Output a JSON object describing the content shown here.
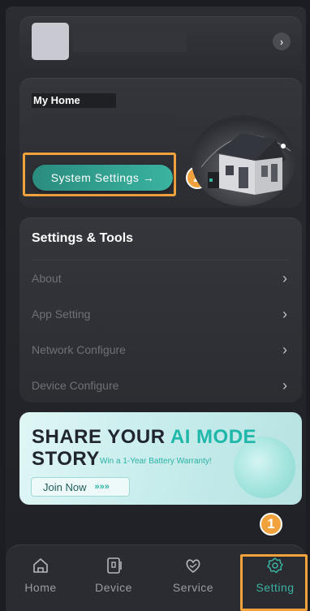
{
  "home_card": {
    "title": "My Home",
    "system_settings_label": "System Settings →",
    "callout_number": "2"
  },
  "settings_card": {
    "title": "Settings & Tools",
    "items": [
      {
        "label": "About"
      },
      {
        "label": "App Setting"
      },
      {
        "label": "Network Configure"
      },
      {
        "label": "Device Configure"
      }
    ]
  },
  "banner": {
    "line1_a": "SHARE YOUR ",
    "line1_b": "AI MODE",
    "line2": "STORY",
    "subtext": "Win a 1-Year Battery Warranty!",
    "join_label": "Join Now",
    "join_arrows": "»»»"
  },
  "callout_tab": "1",
  "tabbar": {
    "tabs": [
      {
        "label": "Home",
        "icon": "home-icon"
      },
      {
        "label": "Device",
        "icon": "device-icon"
      },
      {
        "label": "Service",
        "icon": "service-icon"
      },
      {
        "label": "Setting",
        "icon": "gear-icon",
        "active": true
      }
    ]
  },
  "colors": {
    "accent": "#3ab3a0",
    "highlight": "#f2a23c",
    "background": "#1b1d22"
  }
}
